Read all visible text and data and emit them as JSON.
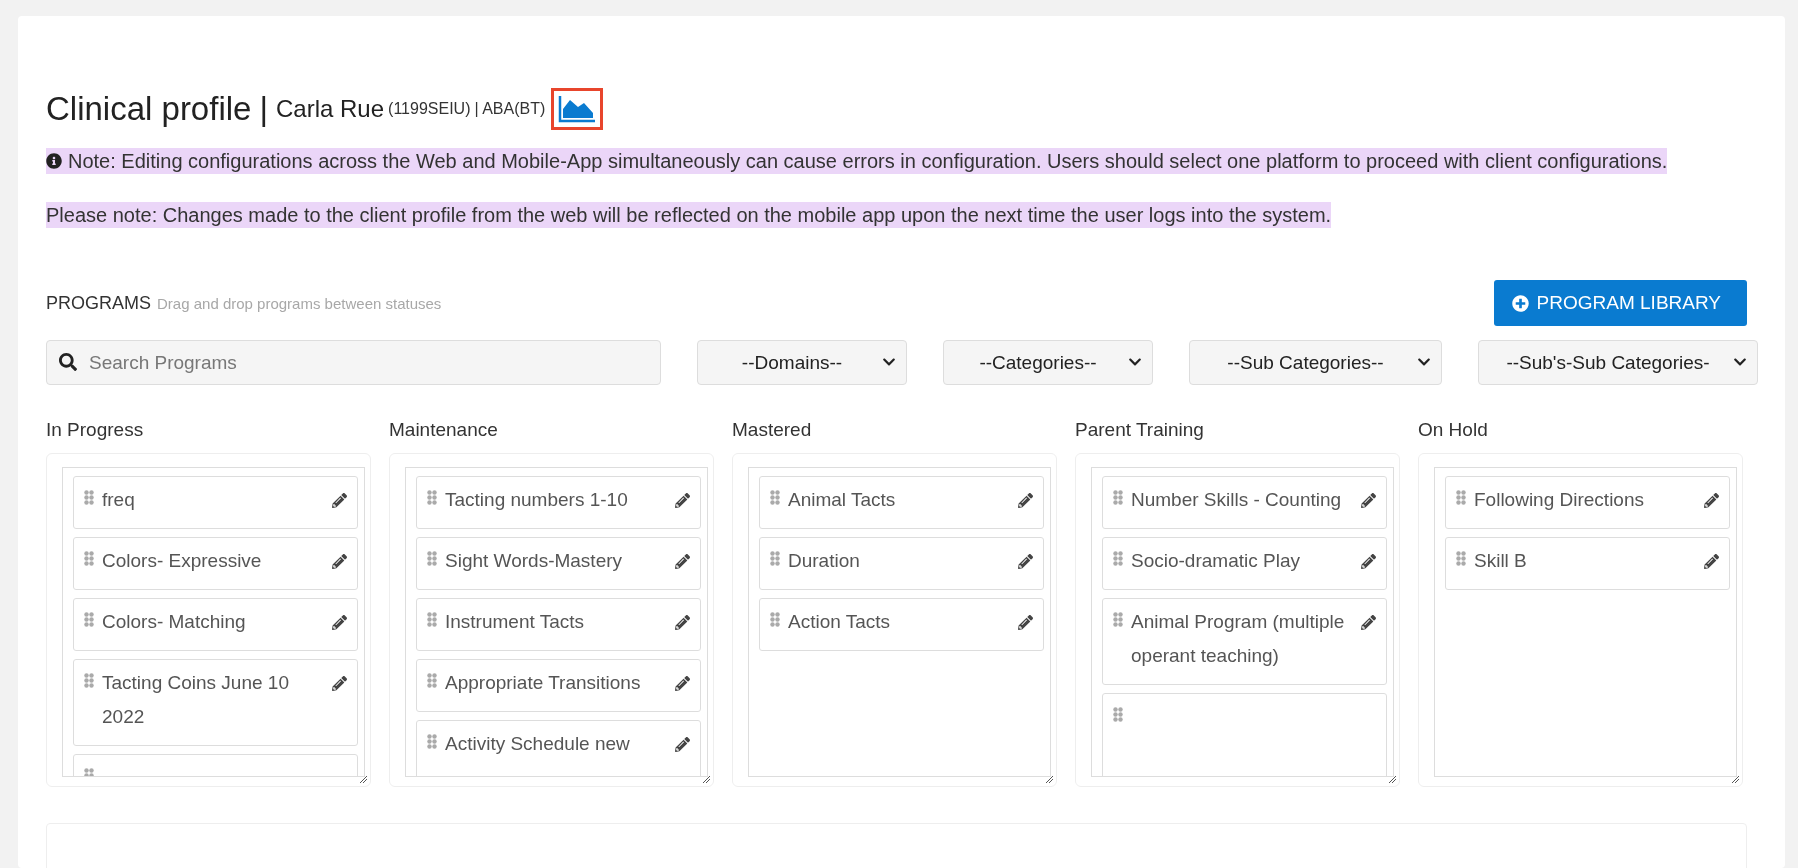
{
  "header": {
    "title": "Clinical profile",
    "separator": "|",
    "client_name": "Carla Rue",
    "client_code": "(1199SEIU)",
    "client_service": "| ABA(BT)"
  },
  "notes": [
    {
      "kind": "info",
      "text": "Note: Editing configurations across the Web and Mobile-App simultaneously can cause errors in configuration. Users should select one platform to proceed with client configurations."
    },
    {
      "kind": "plain",
      "text": "Please note: Changes made to the client profile from the web will be reflected on the mobile app upon the next time the user logs into the system."
    }
  ],
  "programs": {
    "heading": "PROGRAMS",
    "hint": "Drag and drop programs between statuses",
    "library_button": "PROGRAM LIBRARY",
    "search": {
      "placeholder": "Search Programs"
    },
    "filters": [
      "--Domains--",
      "--Categories--",
      "--Sub Categories--",
      "--Sub's-Sub Categories-"
    ]
  },
  "columns": [
    {
      "title": "In Progress",
      "items": [
        {
          "kind": "full",
          "label": "freq"
        },
        {
          "kind": "full",
          "label": "Colors- Expressive"
        },
        {
          "kind": "full",
          "label": "Colors- Matching"
        },
        {
          "kind": "full",
          "label": "Tacting Coins June 10 2022"
        },
        {
          "kind": "cut"
        }
      ]
    },
    {
      "title": "Maintenance",
      "items": [
        {
          "kind": "full",
          "label": "Tacting numbers 1-10"
        },
        {
          "kind": "full",
          "label": "Sight Words-Mastery"
        },
        {
          "kind": "full",
          "label": "Instrument Tacts"
        },
        {
          "kind": "full",
          "label": "Appropriate Transitions"
        },
        {
          "kind": "cut",
          "label": "Activity Schedule new"
        }
      ]
    },
    {
      "title": "Mastered",
      "items": [
        {
          "kind": "full",
          "label": "Animal Tacts"
        },
        {
          "kind": "full",
          "label": "Duration"
        },
        {
          "kind": "full",
          "label": "Action Tacts"
        }
      ]
    },
    {
      "title": "Parent Training",
      "items": [
        {
          "kind": "full",
          "label": "Number Skills - Counting"
        },
        {
          "kind": "full",
          "label": "Socio-dramatic Play"
        },
        {
          "kind": "full",
          "label": "Animal Program (multiple operant teaching)"
        },
        {
          "kind": "cut"
        }
      ]
    },
    {
      "title": "On Hold",
      "items": [
        {
          "kind": "full",
          "label": "Following Directions"
        },
        {
          "kind": "full",
          "label": "Skill B"
        }
      ]
    }
  ]
}
